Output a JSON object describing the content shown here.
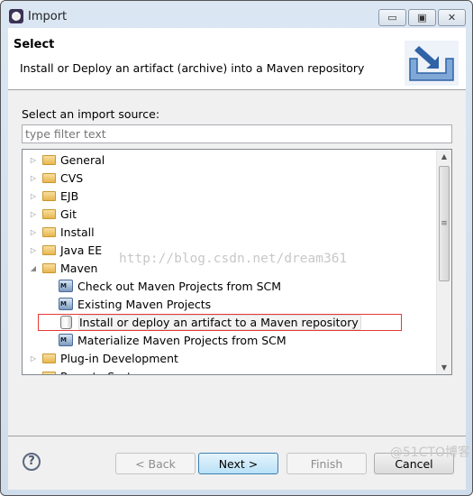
{
  "window": {
    "title": "Import",
    "controls": [
      "minimize",
      "maximize",
      "close"
    ]
  },
  "header": {
    "title": "Select",
    "description": "Install or Deploy an artifact (archive) into a Maven repository",
    "icon": "import-wizard-icon"
  },
  "source_label": "Select an import source:",
  "filter": {
    "value": "",
    "placeholder": "type filter text"
  },
  "tree": [
    {
      "label": "General",
      "level": 0,
      "expanded": false
    },
    {
      "label": "CVS",
      "level": 0,
      "expanded": false
    },
    {
      "label": "EJB",
      "level": 0,
      "expanded": false
    },
    {
      "label": "Git",
      "level": 0,
      "expanded": false
    },
    {
      "label": "Install",
      "level": 0,
      "expanded": false
    },
    {
      "label": "Java EE",
      "level": 0,
      "expanded": false
    },
    {
      "label": "Maven",
      "level": 0,
      "expanded": true
    },
    {
      "label": "Check out Maven Projects from SCM",
      "level": 1
    },
    {
      "label": "Existing Maven Projects",
      "level": 1
    },
    {
      "label": "Install or deploy an artifact to a Maven repository",
      "level": 1,
      "selected": true
    },
    {
      "label": "Materialize Maven Projects from SCM",
      "level": 1
    },
    {
      "label": "Plug-in Development",
      "level": 0,
      "expanded": false
    },
    {
      "label": "Remote Systems",
      "level": 0,
      "expanded": false
    }
  ],
  "watermark": "http://blog.csdn.net/dream361",
  "footer": {
    "back": "< Back",
    "next": "Next >",
    "finish": "Finish",
    "cancel": "Cancel"
  },
  "corner_watermark": "@51CTO博客",
  "colors": {
    "highlight_box": "#e53935",
    "default_button": "#3c7fb1"
  }
}
